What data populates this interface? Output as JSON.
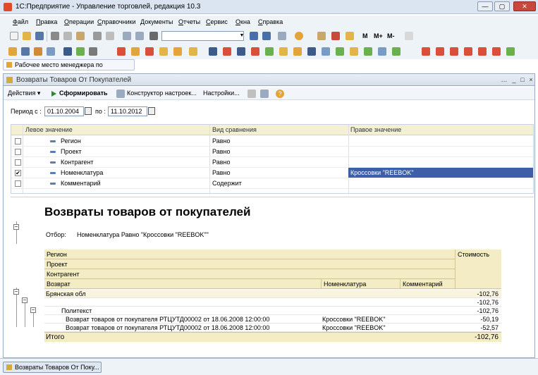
{
  "window": {
    "title": "1С:Предприятие - Управление торговлей, редакция 10.3",
    "min": "—",
    "max": "▢",
    "close": "✕"
  },
  "menu": [
    "Файл",
    "Правка",
    "Операции",
    "Справочники",
    "Документы",
    "Отчеты",
    "Сервис",
    "Окна",
    "Справка"
  ],
  "toolbar": {
    "m": "M",
    "mplus": "M+",
    "mminus": "M-"
  },
  "quicklink": "Рабочее место менеджера по продажам",
  "doc": {
    "title": "Возвраты Товаров От Покупателей",
    "btns": {
      "more": "…",
      "min": "_",
      "max": "□",
      "close": "×"
    },
    "toolbar": {
      "actions": "Действия ▾",
      "form": "Сформировать",
      "constructor": "Конструктор настроек...",
      "settings": "Настройки...",
      "help": "?"
    },
    "period": {
      "from_label": "Период с :",
      "from": "01.10.2004",
      "to_label": "по :",
      "to": "11.10.2012"
    }
  },
  "filter": {
    "headers": {
      "left": "Левое значение",
      "comp": "Вид сравнения",
      "right": "Правое значение"
    },
    "rows": [
      {
        "checked": "",
        "name": "Регион",
        "comp": "Равно",
        "value": ""
      },
      {
        "checked": "",
        "name": "Проект",
        "comp": "Равно",
        "value": ""
      },
      {
        "checked": "",
        "name": "Контрагент",
        "comp": "Равно",
        "value": ""
      },
      {
        "checked": "✔",
        "name": "Номенклатура",
        "comp": "Равно",
        "value": "Кроссовки \"REEBOK\""
      },
      {
        "checked": "",
        "name": "Комментарий",
        "comp": "Содержит",
        "value": ""
      }
    ]
  },
  "report": {
    "title": "Возвраты товаров от покупателей",
    "filter_label": "Отбор:",
    "filter_value": "Номенклатура Равно \"Кроссовки \"REEBOK\"\"",
    "headers": {
      "region": "Регион",
      "project": "Проект",
      "contractor": "Контрагент",
      "return": "Возврат",
      "nomenclature": "Номенклатура",
      "comment": "Комментарий",
      "cost": "Стоимость"
    },
    "rows": [
      {
        "label": "Брянская обл",
        "nom": "",
        "cost": "-102,76"
      },
      {
        "label": "",
        "nom": "",
        "cost": "-102,76"
      },
      {
        "label": "Политекст",
        "nom": "",
        "cost": "-102,76"
      },
      {
        "label": "Возврат товаров от покупателя РТЦУТД00002 от 18.06.2008 12:00:00",
        "nom": "Кроссовки \"REEBOK\"",
        "cost": "-50,19"
      },
      {
        "label": "Возврат товаров от покупателя РТЦУТД00002 от 18.06.2008 12:00:00",
        "nom": "Кроссовки \"REEBOK\"",
        "cost": "-52,57"
      }
    ],
    "total": {
      "label": "Итого",
      "cost": "-102,76"
    }
  },
  "taskbar": {
    "button": "Возвраты Товаров От Поку..."
  }
}
